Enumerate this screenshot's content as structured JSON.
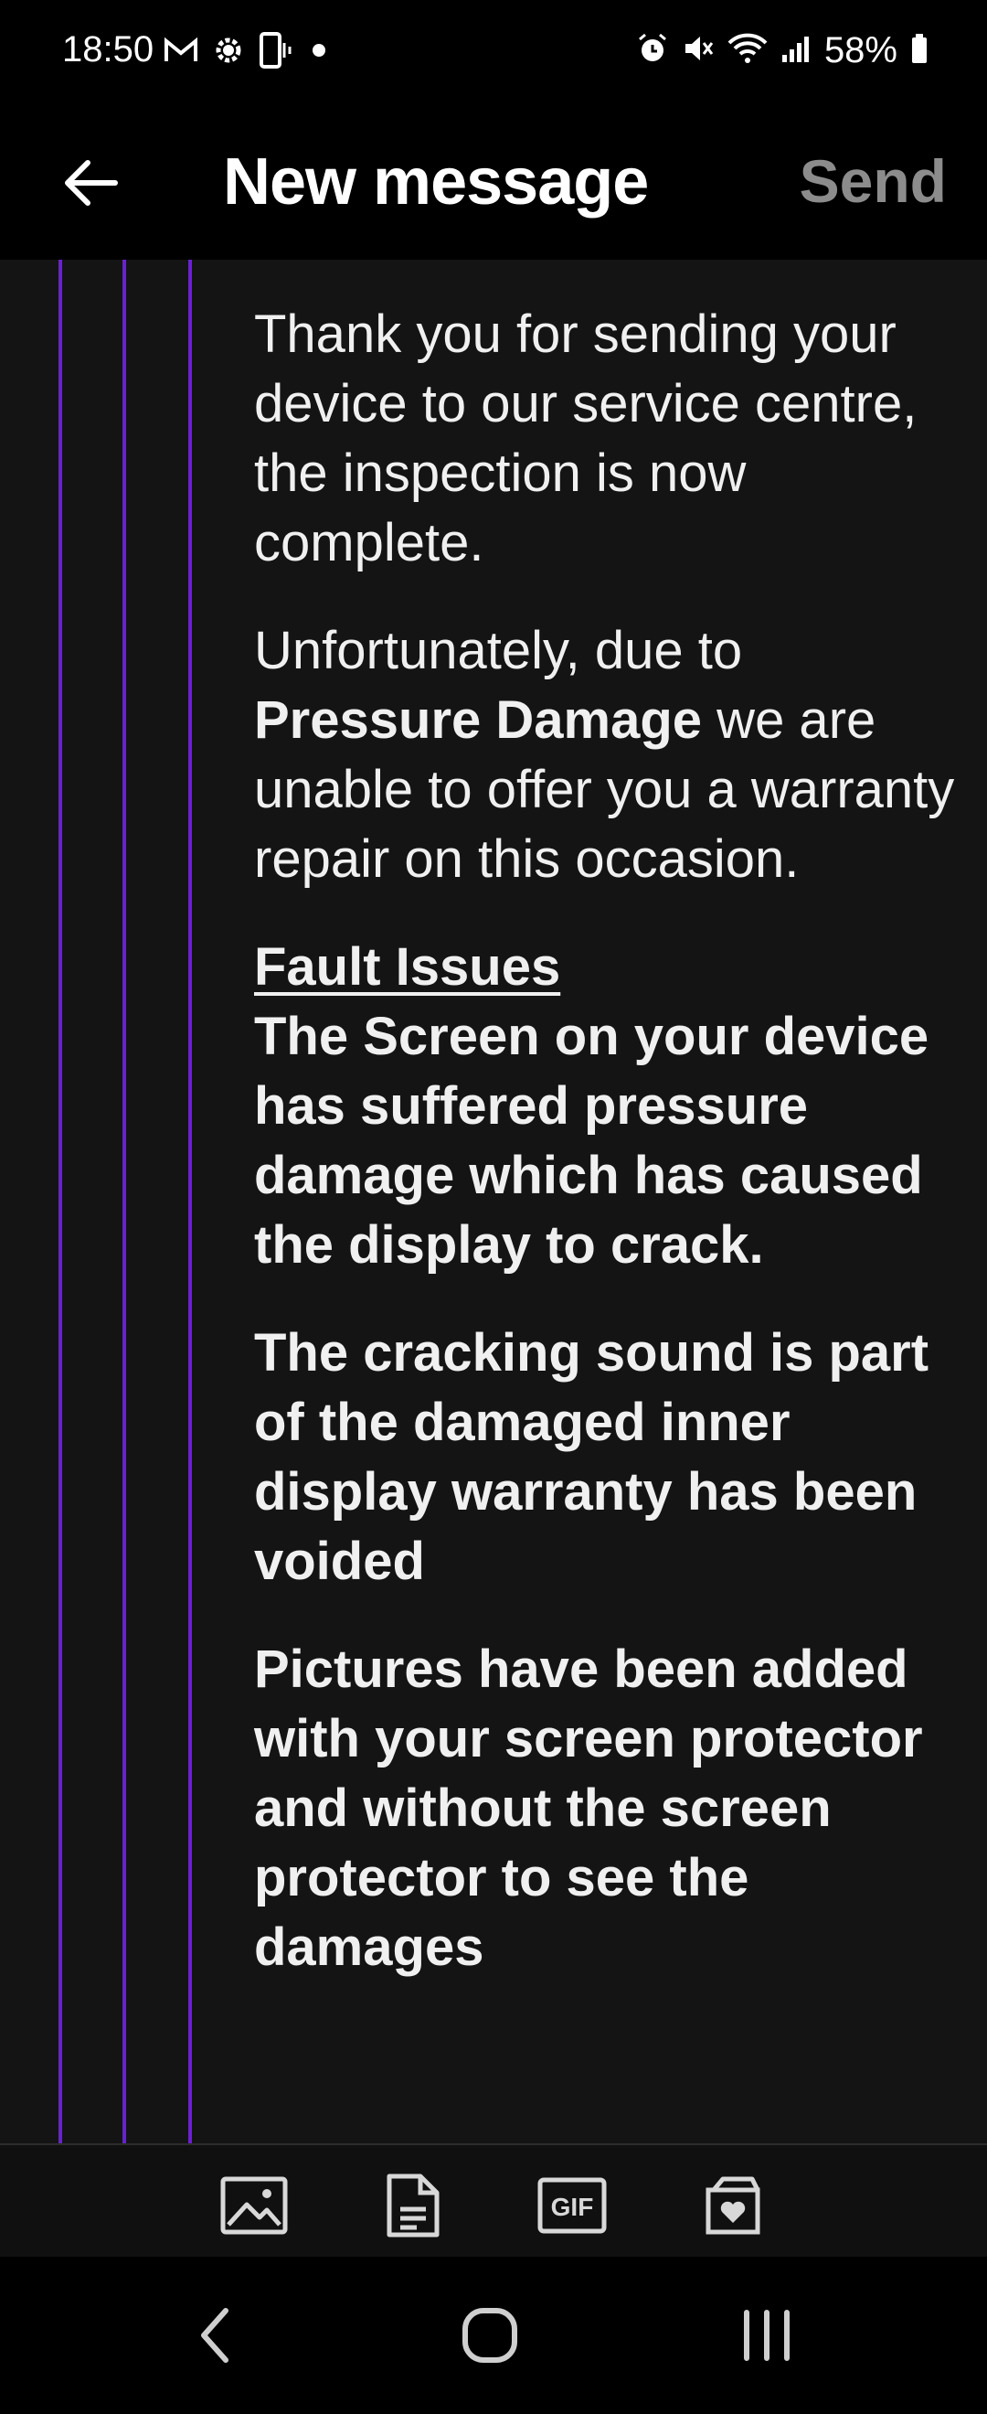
{
  "status_bar": {
    "time": "18:50",
    "battery": "58%",
    "left_icons": [
      "gmail-icon",
      "settings-gear-icon",
      "phone-vibrate-icon",
      "notification-dot-icon"
    ],
    "right_icons": [
      "alarm-icon",
      "mute-icon",
      "wifi-icon",
      "signal-icon",
      "battery-icon"
    ]
  },
  "app_bar": {
    "title": "New message",
    "send_label": "Send",
    "back_icon": "back-arrow-icon"
  },
  "message": {
    "p1": "Thank you for sending your device to our service centre, the inspection is now complete.",
    "p2_before": "Unfortunately, due to ",
    "p2_bold": "Pressure Damage",
    "p2_after": " we are unable to offer you a warranty repair on this occasion.",
    "fault_heading": "Fault Issues",
    "fault_text": "The Screen on your device has suffered pressure damage which has caused the display to crack.",
    "p4": "The cracking sound is part of the damaged inner display warranty has been voided",
    "p5": "Pictures have been added with your screen protector and without the screen protector to see the damages"
  },
  "toolbar": {
    "items": [
      "image-icon",
      "document-icon",
      "gif-icon",
      "sticker-icon"
    ],
    "gif_label": "GIF"
  },
  "nav_bar": {
    "items": [
      "recent-back-icon",
      "home-icon",
      "recents-icon"
    ]
  },
  "colors": {
    "quote_line": "#6a1fd6",
    "background": "#141414",
    "send_disabled": "#8c8c8c"
  }
}
